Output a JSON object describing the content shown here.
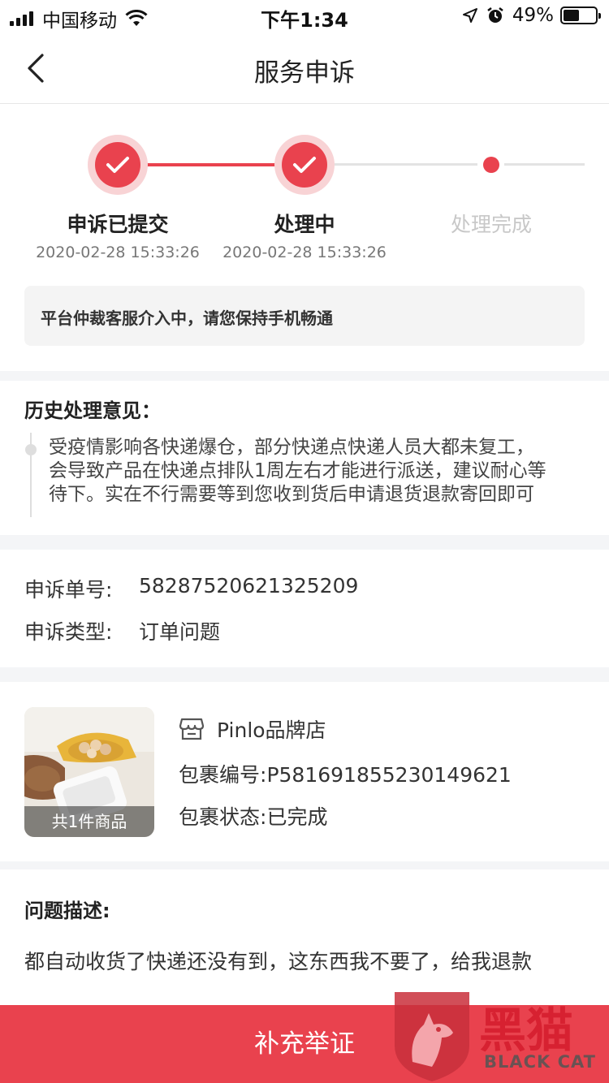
{
  "status_bar": {
    "carrier": "中国移动",
    "time": "下午1:34",
    "battery": "49%",
    "battery_level": 0.49
  },
  "nav": {
    "title": "服务申诉"
  },
  "steps": [
    {
      "label": "申诉已提交",
      "time": "2020-02-28 15:33:26",
      "state": "done"
    },
    {
      "label": "处理中",
      "time": "2020-02-28 15:33:26",
      "state": "done"
    },
    {
      "label": "处理完成",
      "time": "",
      "state": "pending"
    }
  ],
  "notice": "平台仲裁客服介入中，请您保持手机畅通",
  "history": {
    "title": "历史处理意见：",
    "lines": [
      "受疫情影响各快递爆仓，部分快递点快递人员大都未复工，",
      "会导致产品在快递点排队1周左右才能进行派送，建议耐心等",
      "待下。实在不行需要等到您收到货后申请退货退款寄回即可"
    ]
  },
  "appeal": {
    "number_label": "申诉单号:",
    "number": "58287520621325209",
    "type_label": "申诉类型:",
    "type": "订单问题"
  },
  "package": {
    "thumb_caption": "共1件商品",
    "shop": "Pinlo品牌店",
    "id_label": "包裹编号:",
    "id": "P581691855230149621",
    "status_label": "包裹状态:",
    "status": "已完成"
  },
  "problem": {
    "title": "问题描述:",
    "text": "都自动收货了快递还没有到，这东西我不要了，给我退款"
  },
  "bottom": {
    "button": "补充举证"
  },
  "watermark": {
    "title": "黑猫",
    "subtitle": "BLACK CAT"
  },
  "colors": {
    "accent": "#e9424e",
    "accent_light": "#f8d3d5",
    "divider": "#f4f5f7"
  }
}
